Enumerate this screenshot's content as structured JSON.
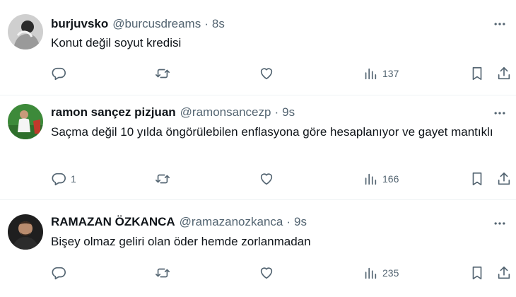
{
  "colors": {
    "text_primary": "#0f1419",
    "text_secondary": "#536471",
    "divider": "#eff3f4"
  },
  "icons": {
    "reply": "reply-icon",
    "retweet": "retweet-icon",
    "like": "heart-icon",
    "views": "views-chart-icon",
    "bookmark": "bookmark-icon",
    "share": "share-icon",
    "more": "more-icon"
  },
  "tweets": [
    {
      "display_name": "burjuvsko",
      "handle": "@burcusdreams",
      "separator": "·",
      "time": "8s",
      "text": "Konut değil soyut kredisi",
      "replies": "",
      "views": "137"
    },
    {
      "display_name": "ramon sançez pizjuan",
      "handle": "@ramonsancezp",
      "separator": "·",
      "time": "9s",
      "text": "Saçma değil 10 yılda öngörülebilen enflasyona göre hesaplanıyor ve gayet mantıklı",
      "replies": "1",
      "views": "166"
    },
    {
      "display_name": "RAMAZAN ÖZKANCA",
      "handle": "@ramazanozkanca",
      "separator": "·",
      "time": "9s",
      "text": "Bişey olmaz geliri olan öder hemde zorlanmadan",
      "replies": "",
      "views": "235"
    }
  ]
}
